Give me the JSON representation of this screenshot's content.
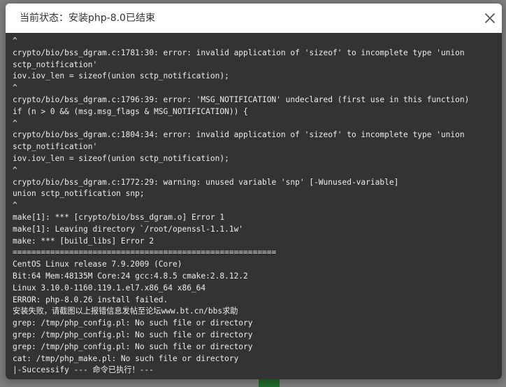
{
  "dialog": {
    "title": "当前状态：安装php-8.0已结束",
    "close_icon": "close-icon"
  },
  "console": {
    "lines": [
      "^",
      "crypto/bio/bss_dgram.c:1781:30: error: invalid application of 'sizeof' to incomplete type 'union",
      "sctp_notification'",
      "iov.iov_len = sizeof(union sctp_notification);",
      "^",
      "crypto/bio/bss_dgram.c:1796:39: error: 'MSG_NOTIFICATION' undeclared (first use in this function)",
      "if (n > 0 && (msg.msg_flags & MSG_NOTIFICATION)) {",
      "^",
      "crypto/bio/bss_dgram.c:1804:34: error: invalid application of 'sizeof' to incomplete type 'union",
      "sctp_notification'",
      "iov.iov_len = sizeof(union sctp_notification);",
      "^",
      "crypto/bio/bss_dgram.c:1772:29: warning: unused variable 'snp' [-Wunused-variable]",
      "union sctp_notification snp;",
      "^",
      "make[1]: *** [crypto/bio/bss_dgram.o] Error 1",
      "make[1]: Leaving directory `/root/openssl-1.1.1w'",
      "make: *** [build_libs] Error 2",
      "========================================================",
      "CentOS Linux release 7.9.2009 (Core)",
      "Bit:64 Mem:48135M Core:24 gcc:4.8.5 cmake:2.8.12.2",
      "Linux 3.10.0-1160.119.1.el7.x86_64 x86_64",
      "ERROR: php-8.0.26 install failed.",
      "安装失败，请截图以上报错信息发帖至论坛www.bt.cn/bbs求助",
      "grep: /tmp/php_config.pl: No such file or directory",
      "grep: /tmp/php_config.pl: No such file or directory",
      "grep: /tmp/php_config.pl: No such file or directory",
      "cat: /tmp/php_make.pl: No such file or directory",
      "|-Successify --- 命令已执行！---"
    ]
  },
  "colors": {
    "console_bg": "#333333",
    "console_text": "#ececec",
    "header_bg": "#ffffff",
    "title_text": "#333333"
  }
}
